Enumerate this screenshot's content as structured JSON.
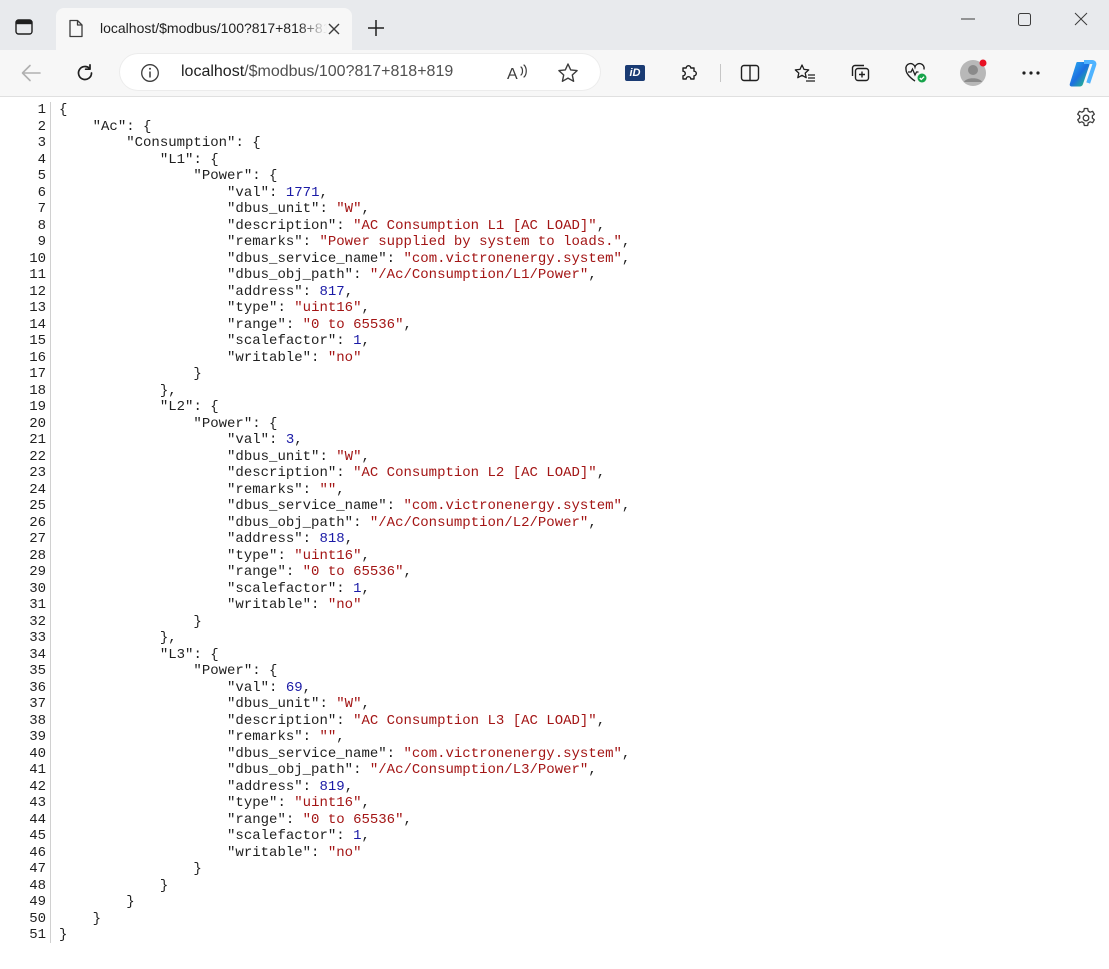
{
  "window": {
    "tab_title": "localhost/$modbus/100?817+818+819",
    "minimize_icon": "minimize-icon",
    "maximize_icon": "maximize-icon",
    "close_icon": "close-icon"
  },
  "toolbar": {
    "url_host": "localhost",
    "url_path": "/$modbus/100?817+818+819",
    "extension_badge": "iD"
  },
  "code": {
    "line_numbers": [
      "1",
      "2",
      "3",
      "4",
      "5",
      "6",
      "7",
      "8",
      "9",
      "10",
      "11",
      "12",
      "13",
      "14",
      "15",
      "16",
      "17",
      "18",
      "19",
      "20",
      "21",
      "22",
      "23",
      "24",
      "25",
      "26",
      "27",
      "28",
      "29",
      "30",
      "31",
      "32",
      "33",
      "34",
      "35",
      "36",
      "37",
      "38",
      "39",
      "40",
      "41",
      "42",
      "43",
      "44",
      "45",
      "46",
      "47",
      "48",
      "49",
      "50",
      "51"
    ],
    "lines": [
      [
        [
          "p",
          "{"
        ]
      ],
      [
        [
          "p",
          "    "
        ],
        [
          "k",
          "\"Ac\""
        ],
        [
          "p",
          ": {"
        ]
      ],
      [
        [
          "p",
          "        "
        ],
        [
          "k",
          "\"Consumption\""
        ],
        [
          "p",
          ": {"
        ]
      ],
      [
        [
          "p",
          "            "
        ],
        [
          "k",
          "\"L1\""
        ],
        [
          "p",
          ": {"
        ]
      ],
      [
        [
          "p",
          "                "
        ],
        [
          "k",
          "\"Power\""
        ],
        [
          "p",
          ": {"
        ]
      ],
      [
        [
          "p",
          "                    "
        ],
        [
          "k",
          "\"val\""
        ],
        [
          "p",
          ": "
        ],
        [
          "n",
          "1771"
        ],
        [
          "p",
          ","
        ]
      ],
      [
        [
          "p",
          "                    "
        ],
        [
          "k",
          "\"dbus_unit\""
        ],
        [
          "p",
          ": "
        ],
        [
          "s",
          "\"W\""
        ],
        [
          "p",
          ","
        ]
      ],
      [
        [
          "p",
          "                    "
        ],
        [
          "k",
          "\"description\""
        ],
        [
          "p",
          ": "
        ],
        [
          "s",
          "\"AC Consumption L1 [AC LOAD]\""
        ],
        [
          "p",
          ","
        ]
      ],
      [
        [
          "p",
          "                    "
        ],
        [
          "k",
          "\"remarks\""
        ],
        [
          "p",
          ": "
        ],
        [
          "s",
          "\"Power supplied by system to loads.\""
        ],
        [
          "p",
          ","
        ]
      ],
      [
        [
          "p",
          "                    "
        ],
        [
          "k",
          "\"dbus_service_name\""
        ],
        [
          "p",
          ": "
        ],
        [
          "s",
          "\"com.victronenergy.system\""
        ],
        [
          "p",
          ","
        ]
      ],
      [
        [
          "p",
          "                    "
        ],
        [
          "k",
          "\"dbus_obj_path\""
        ],
        [
          "p",
          ": "
        ],
        [
          "s",
          "\"/Ac/Consumption/L1/Power\""
        ],
        [
          "p",
          ","
        ]
      ],
      [
        [
          "p",
          "                    "
        ],
        [
          "k",
          "\"address\""
        ],
        [
          "p",
          ": "
        ],
        [
          "n",
          "817"
        ],
        [
          "p",
          ","
        ]
      ],
      [
        [
          "p",
          "                    "
        ],
        [
          "k",
          "\"type\""
        ],
        [
          "p",
          ": "
        ],
        [
          "s",
          "\"uint16\""
        ],
        [
          "p",
          ","
        ]
      ],
      [
        [
          "p",
          "                    "
        ],
        [
          "k",
          "\"range\""
        ],
        [
          "p",
          ": "
        ],
        [
          "s",
          "\"0 to 65536\""
        ],
        [
          "p",
          ","
        ]
      ],
      [
        [
          "p",
          "                    "
        ],
        [
          "k",
          "\"scalefactor\""
        ],
        [
          "p",
          ": "
        ],
        [
          "n",
          "1"
        ],
        [
          "p",
          ","
        ]
      ],
      [
        [
          "p",
          "                    "
        ],
        [
          "k",
          "\"writable\""
        ],
        [
          "p",
          ": "
        ],
        [
          "s",
          "\"no\""
        ]
      ],
      [
        [
          "p",
          "                }"
        ]
      ],
      [
        [
          "p",
          "            },"
        ]
      ],
      [
        [
          "p",
          "            "
        ],
        [
          "k",
          "\"L2\""
        ],
        [
          "p",
          ": {"
        ]
      ],
      [
        [
          "p",
          "                "
        ],
        [
          "k",
          "\"Power\""
        ],
        [
          "p",
          ": {"
        ]
      ],
      [
        [
          "p",
          "                    "
        ],
        [
          "k",
          "\"val\""
        ],
        [
          "p",
          ": "
        ],
        [
          "n",
          "3"
        ],
        [
          "p",
          ","
        ]
      ],
      [
        [
          "p",
          "                    "
        ],
        [
          "k",
          "\"dbus_unit\""
        ],
        [
          "p",
          ": "
        ],
        [
          "s",
          "\"W\""
        ],
        [
          "p",
          ","
        ]
      ],
      [
        [
          "p",
          "                    "
        ],
        [
          "k",
          "\"description\""
        ],
        [
          "p",
          ": "
        ],
        [
          "s",
          "\"AC Consumption L2 [AC LOAD]\""
        ],
        [
          "p",
          ","
        ]
      ],
      [
        [
          "p",
          "                    "
        ],
        [
          "k",
          "\"remarks\""
        ],
        [
          "p",
          ": "
        ],
        [
          "s",
          "\"\""
        ],
        [
          "p",
          ","
        ]
      ],
      [
        [
          "p",
          "                    "
        ],
        [
          "k",
          "\"dbus_service_name\""
        ],
        [
          "p",
          ": "
        ],
        [
          "s",
          "\"com.victronenergy.system\""
        ],
        [
          "p",
          ","
        ]
      ],
      [
        [
          "p",
          "                    "
        ],
        [
          "k",
          "\"dbus_obj_path\""
        ],
        [
          "p",
          ": "
        ],
        [
          "s",
          "\"/Ac/Consumption/L2/Power\""
        ],
        [
          "p",
          ","
        ]
      ],
      [
        [
          "p",
          "                    "
        ],
        [
          "k",
          "\"address\""
        ],
        [
          "p",
          ": "
        ],
        [
          "n",
          "818"
        ],
        [
          "p",
          ","
        ]
      ],
      [
        [
          "p",
          "                    "
        ],
        [
          "k",
          "\"type\""
        ],
        [
          "p",
          ": "
        ],
        [
          "s",
          "\"uint16\""
        ],
        [
          "p",
          ","
        ]
      ],
      [
        [
          "p",
          "                    "
        ],
        [
          "k",
          "\"range\""
        ],
        [
          "p",
          ": "
        ],
        [
          "s",
          "\"0 to 65536\""
        ],
        [
          "p",
          ","
        ]
      ],
      [
        [
          "p",
          "                    "
        ],
        [
          "k",
          "\"scalefactor\""
        ],
        [
          "p",
          ": "
        ],
        [
          "n",
          "1"
        ],
        [
          "p",
          ","
        ]
      ],
      [
        [
          "p",
          "                    "
        ],
        [
          "k",
          "\"writable\""
        ],
        [
          "p",
          ": "
        ],
        [
          "s",
          "\"no\""
        ]
      ],
      [
        [
          "p",
          "                }"
        ]
      ],
      [
        [
          "p",
          "            },"
        ]
      ],
      [
        [
          "p",
          "            "
        ],
        [
          "k",
          "\"L3\""
        ],
        [
          "p",
          ": {"
        ]
      ],
      [
        [
          "p",
          "                "
        ],
        [
          "k",
          "\"Power\""
        ],
        [
          "p",
          ": {"
        ]
      ],
      [
        [
          "p",
          "                    "
        ],
        [
          "k",
          "\"val\""
        ],
        [
          "p",
          ": "
        ],
        [
          "n",
          "69"
        ],
        [
          "p",
          ","
        ]
      ],
      [
        [
          "p",
          "                    "
        ],
        [
          "k",
          "\"dbus_unit\""
        ],
        [
          "p",
          ": "
        ],
        [
          "s",
          "\"W\""
        ],
        [
          "p",
          ","
        ]
      ],
      [
        [
          "p",
          "                    "
        ],
        [
          "k",
          "\"description\""
        ],
        [
          "p",
          ": "
        ],
        [
          "s",
          "\"AC Consumption L3 [AC LOAD]\""
        ],
        [
          "p",
          ","
        ]
      ],
      [
        [
          "p",
          "                    "
        ],
        [
          "k",
          "\"remarks\""
        ],
        [
          "p",
          ": "
        ],
        [
          "s",
          "\"\""
        ],
        [
          "p",
          ","
        ]
      ],
      [
        [
          "p",
          "                    "
        ],
        [
          "k",
          "\"dbus_service_name\""
        ],
        [
          "p",
          ": "
        ],
        [
          "s",
          "\"com.victronenergy.system\""
        ],
        [
          "p",
          ","
        ]
      ],
      [
        [
          "p",
          "                    "
        ],
        [
          "k",
          "\"dbus_obj_path\""
        ],
        [
          "p",
          ": "
        ],
        [
          "s",
          "\"/Ac/Consumption/L3/Power\""
        ],
        [
          "p",
          ","
        ]
      ],
      [
        [
          "p",
          "                    "
        ],
        [
          "k",
          "\"address\""
        ],
        [
          "p",
          ": "
        ],
        [
          "n",
          "819"
        ],
        [
          "p",
          ","
        ]
      ],
      [
        [
          "p",
          "                    "
        ],
        [
          "k",
          "\"type\""
        ],
        [
          "p",
          ": "
        ],
        [
          "s",
          "\"uint16\""
        ],
        [
          "p",
          ","
        ]
      ],
      [
        [
          "p",
          "                    "
        ],
        [
          "k",
          "\"range\""
        ],
        [
          "p",
          ": "
        ],
        [
          "s",
          "\"0 to 65536\""
        ],
        [
          "p",
          ","
        ]
      ],
      [
        [
          "p",
          "                    "
        ],
        [
          "k",
          "\"scalefactor\""
        ],
        [
          "p",
          ": "
        ],
        [
          "n",
          "1"
        ],
        [
          "p",
          ","
        ]
      ],
      [
        [
          "p",
          "                    "
        ],
        [
          "k",
          "\"writable\""
        ],
        [
          "p",
          ": "
        ],
        [
          "s",
          "\"no\""
        ]
      ],
      [
        [
          "p",
          "                }"
        ]
      ],
      [
        [
          "p",
          "            }"
        ]
      ],
      [
        [
          "p",
          "        }"
        ]
      ],
      [
        [
          "p",
          "    }"
        ]
      ],
      [
        [
          "p",
          "}"
        ]
      ]
    ]
  },
  "colors": {
    "key": "#1f1f1f",
    "string": "#a31515",
    "number": "#1a1aa6",
    "accent": "#0067c0"
  }
}
